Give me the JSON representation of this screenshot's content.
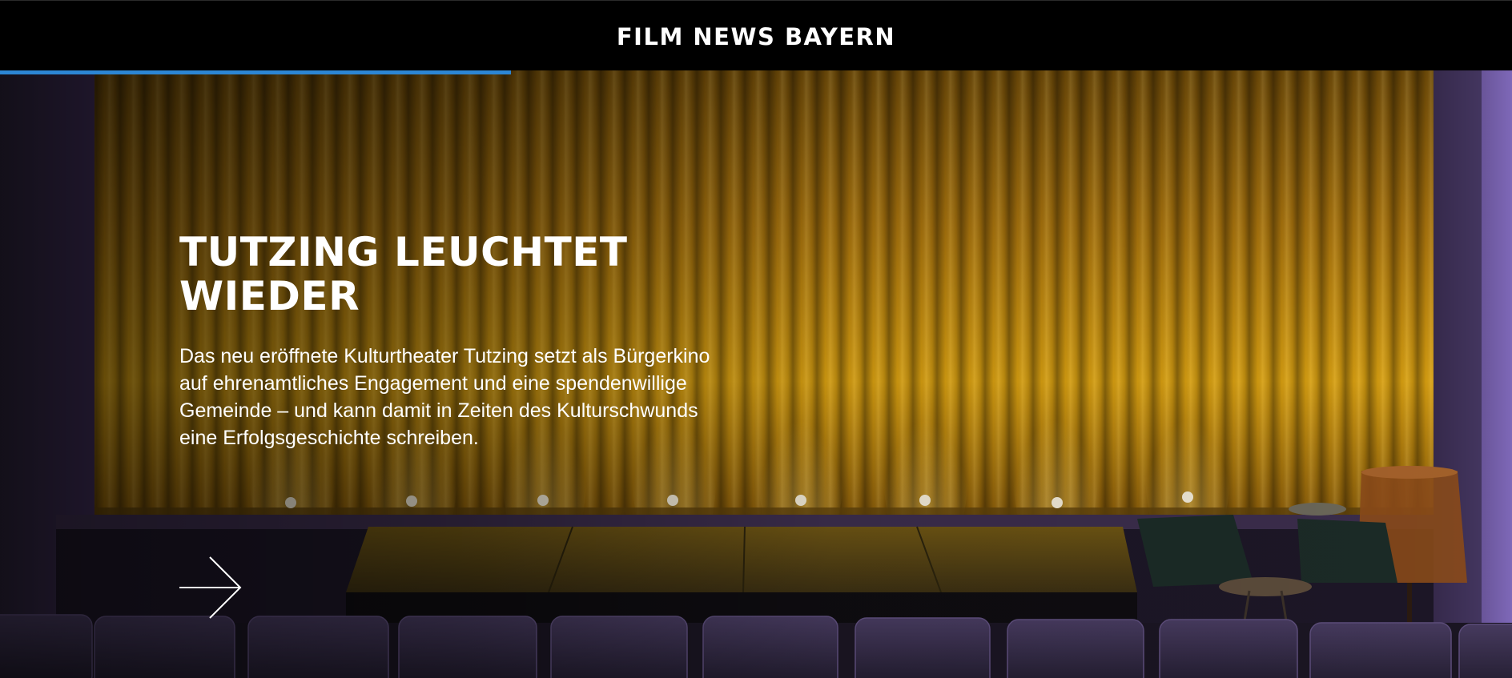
{
  "header": {
    "logo_text": "FILM NEWS BAYERN"
  },
  "reading_progress": {
    "fraction": 0.338,
    "color": "#2c86d4"
  },
  "hero": {
    "headline": "TUTZING LEUCHTET WIEDER",
    "teaser": "Das neu eröffnete Kulturtheater Tutzing setzt als Bürgerkino auf ehrenamtliches Engagement und eine spendenwillige Gemeinde – und kann damit in Zeiten des Kulturschwunds eine Erfolgsgeschichte schreiben.",
    "cta_icon": "arrow-right-icon",
    "image": "cinema-stage-curtain-image"
  },
  "colors": {
    "header_bg": "#000000",
    "text": "#ffffff",
    "curtain": "#c9900f"
  }
}
